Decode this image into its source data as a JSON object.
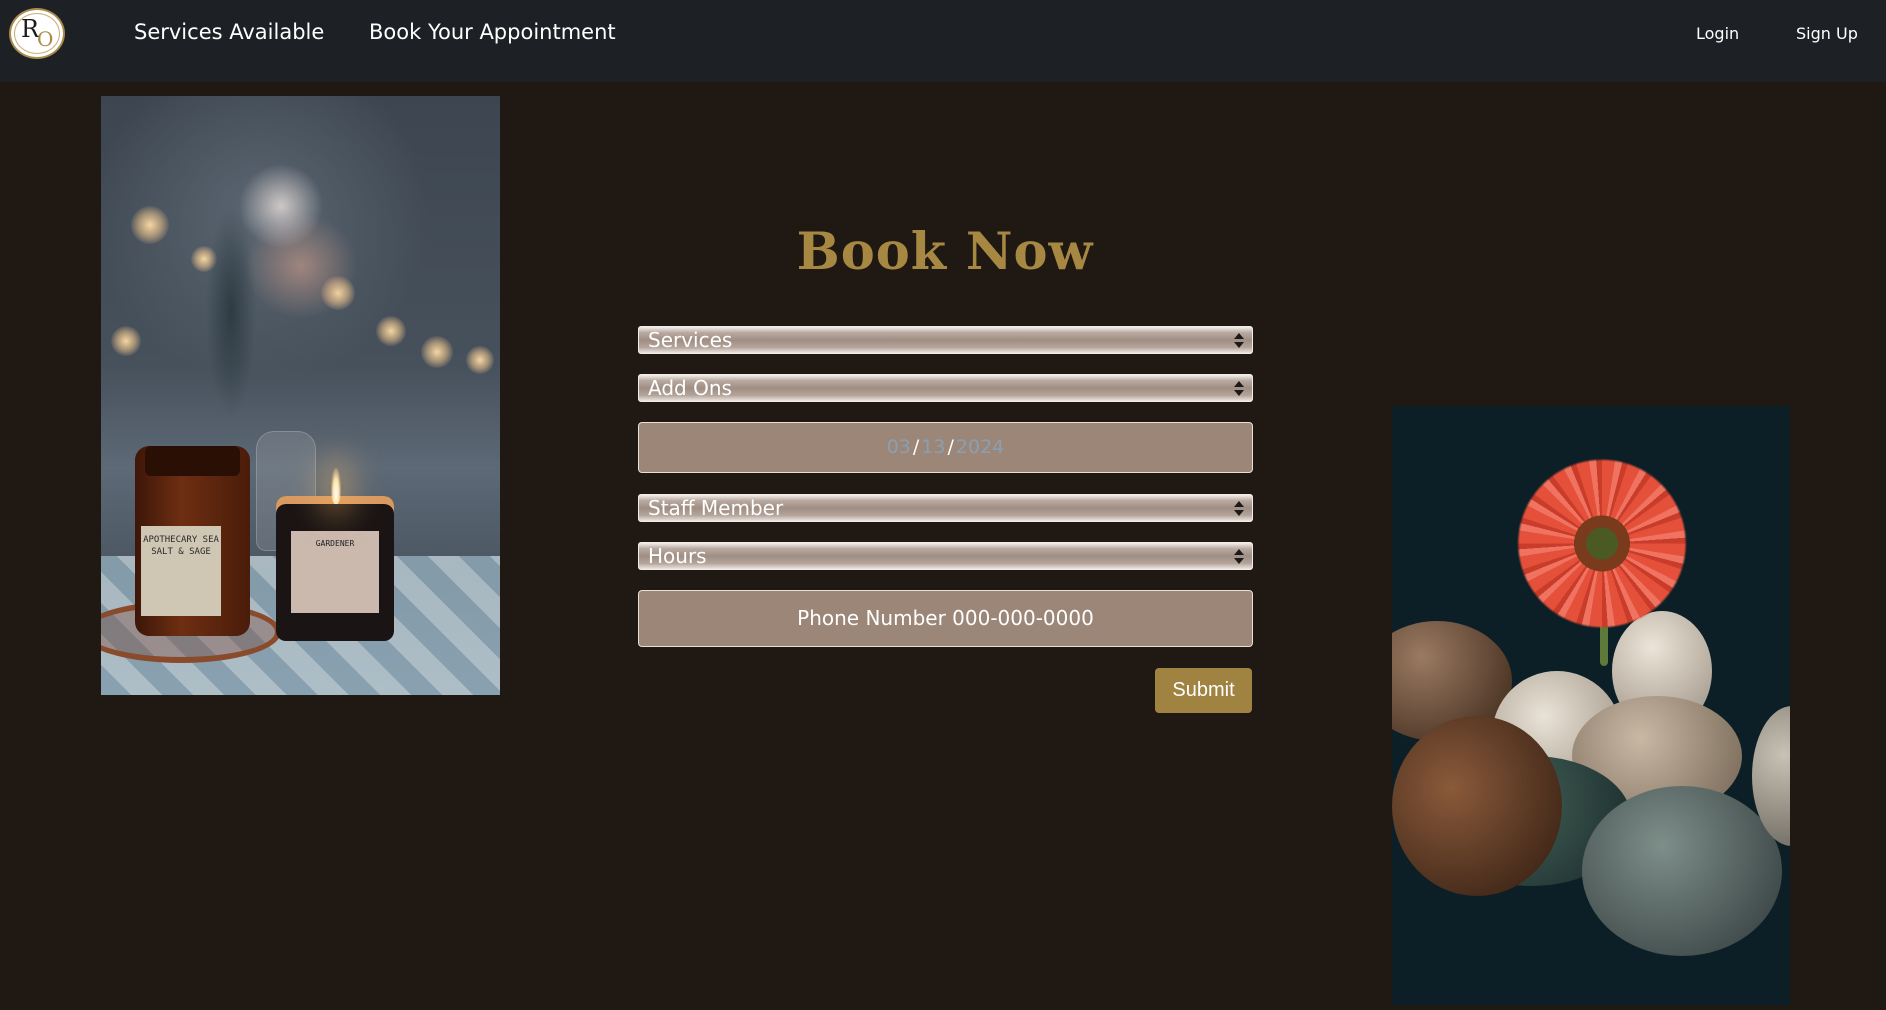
{
  "nav": {
    "logo_text": "RO",
    "logo_r": "R",
    "logo_o": "O",
    "links": {
      "services": "Services Available",
      "book": "Book Your Appointment",
      "login": "Login",
      "signup": "Sign Up"
    }
  },
  "form": {
    "title": "Book Now",
    "services_select": "Services",
    "addons_select": "Add Ons",
    "date": {
      "month": "03",
      "day": "13",
      "year": "2024",
      "separator": "/"
    },
    "staff_select": "Staff Member",
    "hours_select": "Hours",
    "phone_placeholder": "Phone Number 000-000-0000",
    "submit_label": "Submit"
  },
  "photos": {
    "left": {
      "jar_label": "APOTHECARY SEA SALT & SAGE",
      "candle_label": "GARDENER"
    }
  },
  "colors": {
    "background": "#201813",
    "nav_background": "#1d2024",
    "accent_gold": "#a78842",
    "input_fill": "#9b8677",
    "submit_fill": "#a08341"
  },
  "icons": {
    "select_arrow": "up-down-arrows-icon",
    "logo": "ro-monogram-logo"
  }
}
